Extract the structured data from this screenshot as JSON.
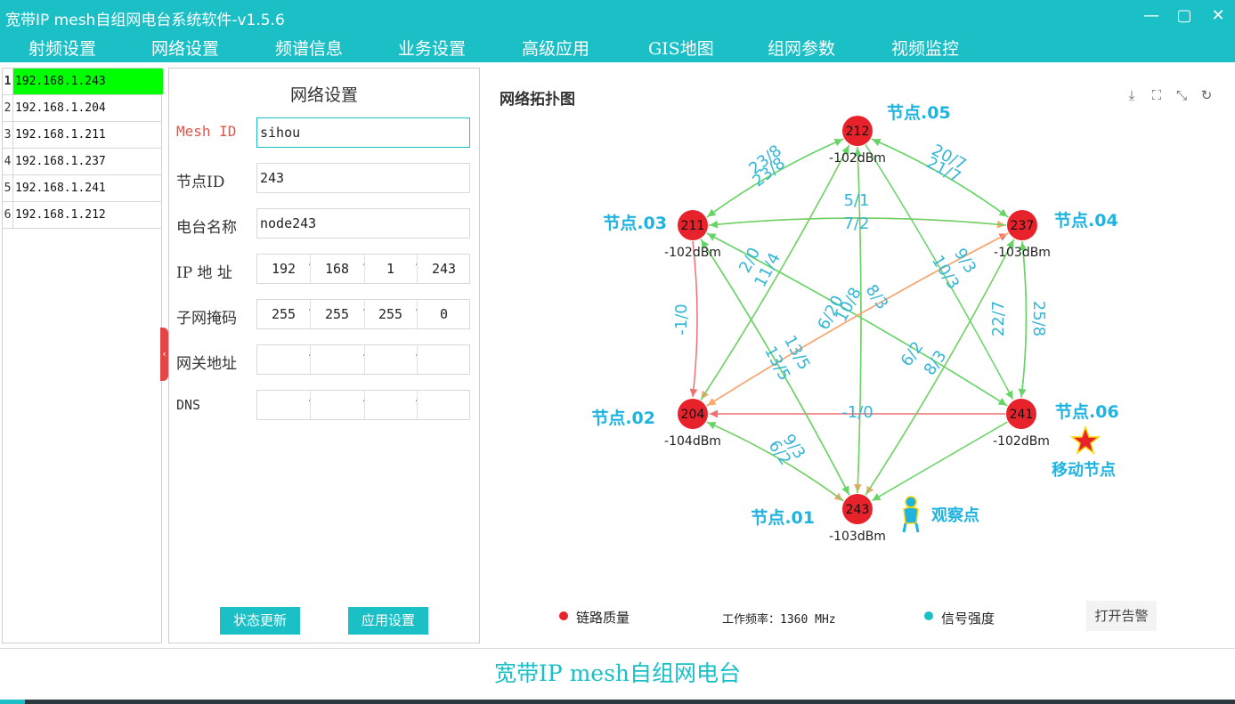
{
  "window": {
    "title": "宽带IP mesh自组网电台系统软件-v1.5.6",
    "minimize": "—",
    "maximize": "▢",
    "close": "✕"
  },
  "menu": [
    "射频设置",
    "网络设置",
    "频谱信息",
    "业务设置",
    "高级应用",
    "GIS地图",
    "组网参数",
    "视频监控"
  ],
  "node_list": [
    {
      "num": "1",
      "ip": "192.168.1.243",
      "selected": true
    },
    {
      "num": "2",
      "ip": "192.168.1.204",
      "selected": false
    },
    {
      "num": "3",
      "ip": "192.168.1.211",
      "selected": false
    },
    {
      "num": "4",
      "ip": "192.168.1.237",
      "selected": false
    },
    {
      "num": "5",
      "ip": "192.168.1.241",
      "selected": false
    },
    {
      "num": "6",
      "ip": "192.168.1.212",
      "selected": false
    }
  ],
  "settings": {
    "title": "网络设置",
    "mesh_id_label": "Mesh ID",
    "mesh_id_value": "sihou",
    "node_id_label": "节点ID",
    "node_id_value": "243",
    "radio_name_label": "电台名称",
    "radio_name_value": "node243",
    "ip_label": "IP 地 址",
    "ip": [
      "192",
      "168",
      "1",
      "243"
    ],
    "mask_label": "子网掩码",
    "mask": [
      "255",
      "255",
      "255",
      "0"
    ],
    "gateway_label": "网关地址",
    "gateway": [
      "",
      "",
      "",
      ""
    ],
    "dns_label": "DNS",
    "dns": [
      "",
      "",
      "",
      ""
    ],
    "refresh_button": "状态更新",
    "apply_button": "应用设置"
  },
  "topology": {
    "title": "网络拓扑图",
    "icons": [
      "download-icon",
      "fullscreen-icon",
      "shrink-icon",
      "refresh-icon"
    ],
    "nodes": [
      {
        "id": "212",
        "name": "节点.05",
        "signal": "-102dBm"
      },
      {
        "id": "237",
        "name": "节点.04",
        "signal": "-103dBm"
      },
      {
        "id": "241",
        "name": "节点.06",
        "signal": "-102dBm"
      },
      {
        "id": "243",
        "name": "节点.01",
        "signal": "-103dBm"
      },
      {
        "id": "204",
        "name": "节点.02",
        "signal": "-104dBm"
      },
      {
        "id": "211",
        "name": "节点.03",
        "signal": "-102dBm"
      }
    ],
    "link_labels": [
      "23/8",
      "23/8",
      "20/7",
      "21/7",
      "5/1",
      "7/2",
      "2/0",
      "11/4",
      "9/3",
      "10/3",
      "25/8",
      "22/7",
      "-1/0",
      "6/20",
      "10/8",
      "8/3",
      "6/2",
      "8/3",
      "13/5",
      "13/5",
      "-1/0",
      "9/3",
      "6/2"
    ],
    "mobile_node_label": "移动节点",
    "observer_label": "观察点",
    "colors": {
      "node": "#e8222b",
      "good_link": "#66d466",
      "mid_link": "#f7a86a",
      "bad_link": "#f07070",
      "label": "#35b6d6",
      "node_name": "#1fb3e0"
    }
  },
  "legend": {
    "link_quality": "链路质量",
    "frequency": "工作频率：1360 MHz",
    "signal_strength": "信号强度",
    "alarm_button": "打开告警",
    "link_color": "#e8222b",
    "signal_color": "#1ac0c6"
  },
  "footer": {
    "text": "宽带IP mesh自组网电台"
  }
}
